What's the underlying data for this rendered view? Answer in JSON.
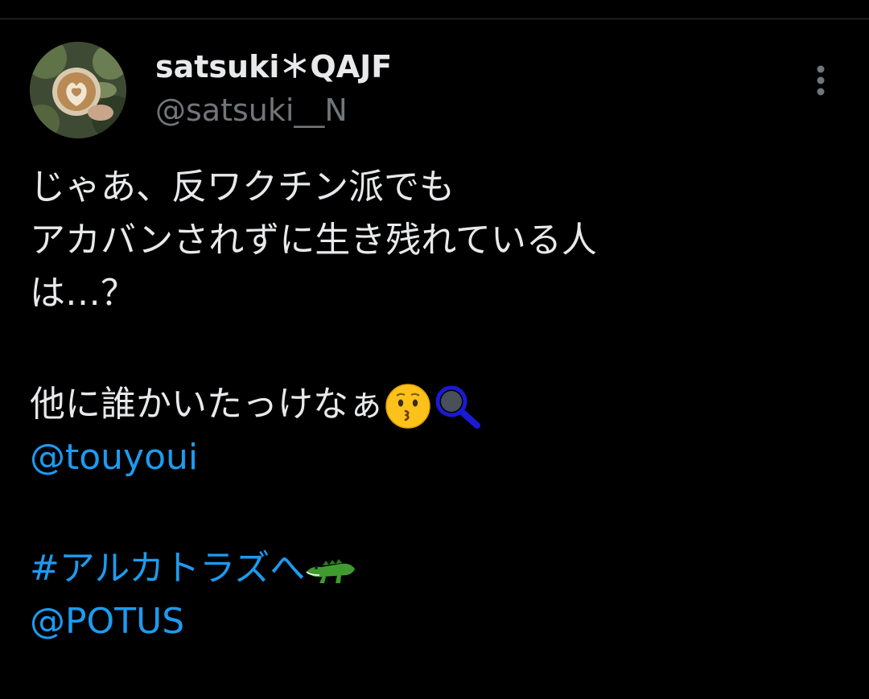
{
  "tweet": {
    "author": {
      "display_name": "satsuki＊QAJF",
      "handle": "@satsuki__N",
      "avatar_icon": "latte-art-avatar"
    },
    "more_icon": "more-vertical-icon",
    "text_lines": [
      "じゃあ、反ワクチン派でも",
      "アカバンされずに生き残れている人",
      "は…？"
    ],
    "line_4": "他に誰かいたっけなぁ",
    "emojis": {
      "kissing_face": "kissing-face-emoji",
      "magnifier": "magnifying-glass-emoji",
      "crocodile": "crocodile-emoji"
    },
    "mention_1": "@touyoui",
    "hashtag": "#アルカトラズへ",
    "mention_2": "@POTUS"
  },
  "colors": {
    "background": "#000000",
    "text": "#e7e9ea",
    "secondary_text": "#71767b",
    "link": "#1d9bf0",
    "divider": "#2f3336"
  }
}
